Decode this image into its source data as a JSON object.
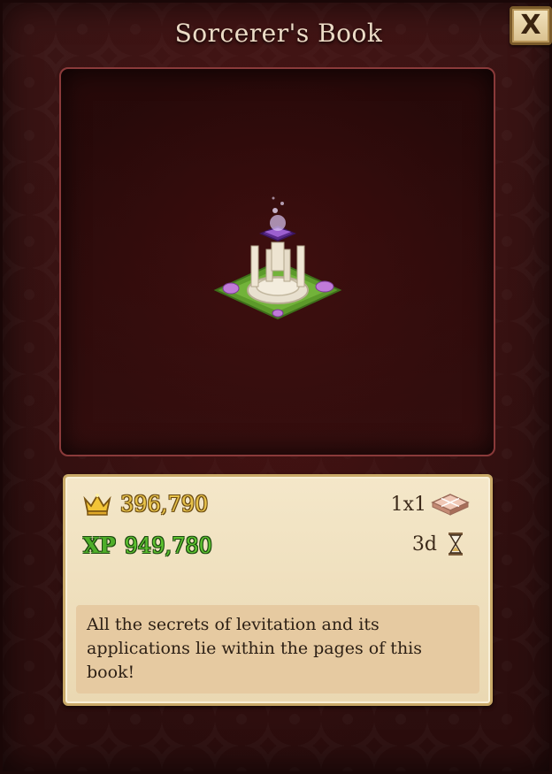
{
  "window": {
    "title": "Sorcerer's Book",
    "close_label": "X"
  },
  "item": {
    "image_name": "sorcerers-book-building",
    "cost": "396,790",
    "xp_label": "XP",
    "xp": "949,780",
    "size": "1x1",
    "build_time": "3d",
    "description": "All the secrets of levitation and its applications lie within the pages of this book!"
  },
  "colors": {
    "gold": "#e7c24a",
    "xp_green": "#5cc130",
    "panel_bg": "#2a0d0d",
    "info_bg": "#f4e7c9"
  },
  "icons": [
    "crown-icon",
    "tile-size-icon",
    "hourglass-icon",
    "close-icon"
  ]
}
